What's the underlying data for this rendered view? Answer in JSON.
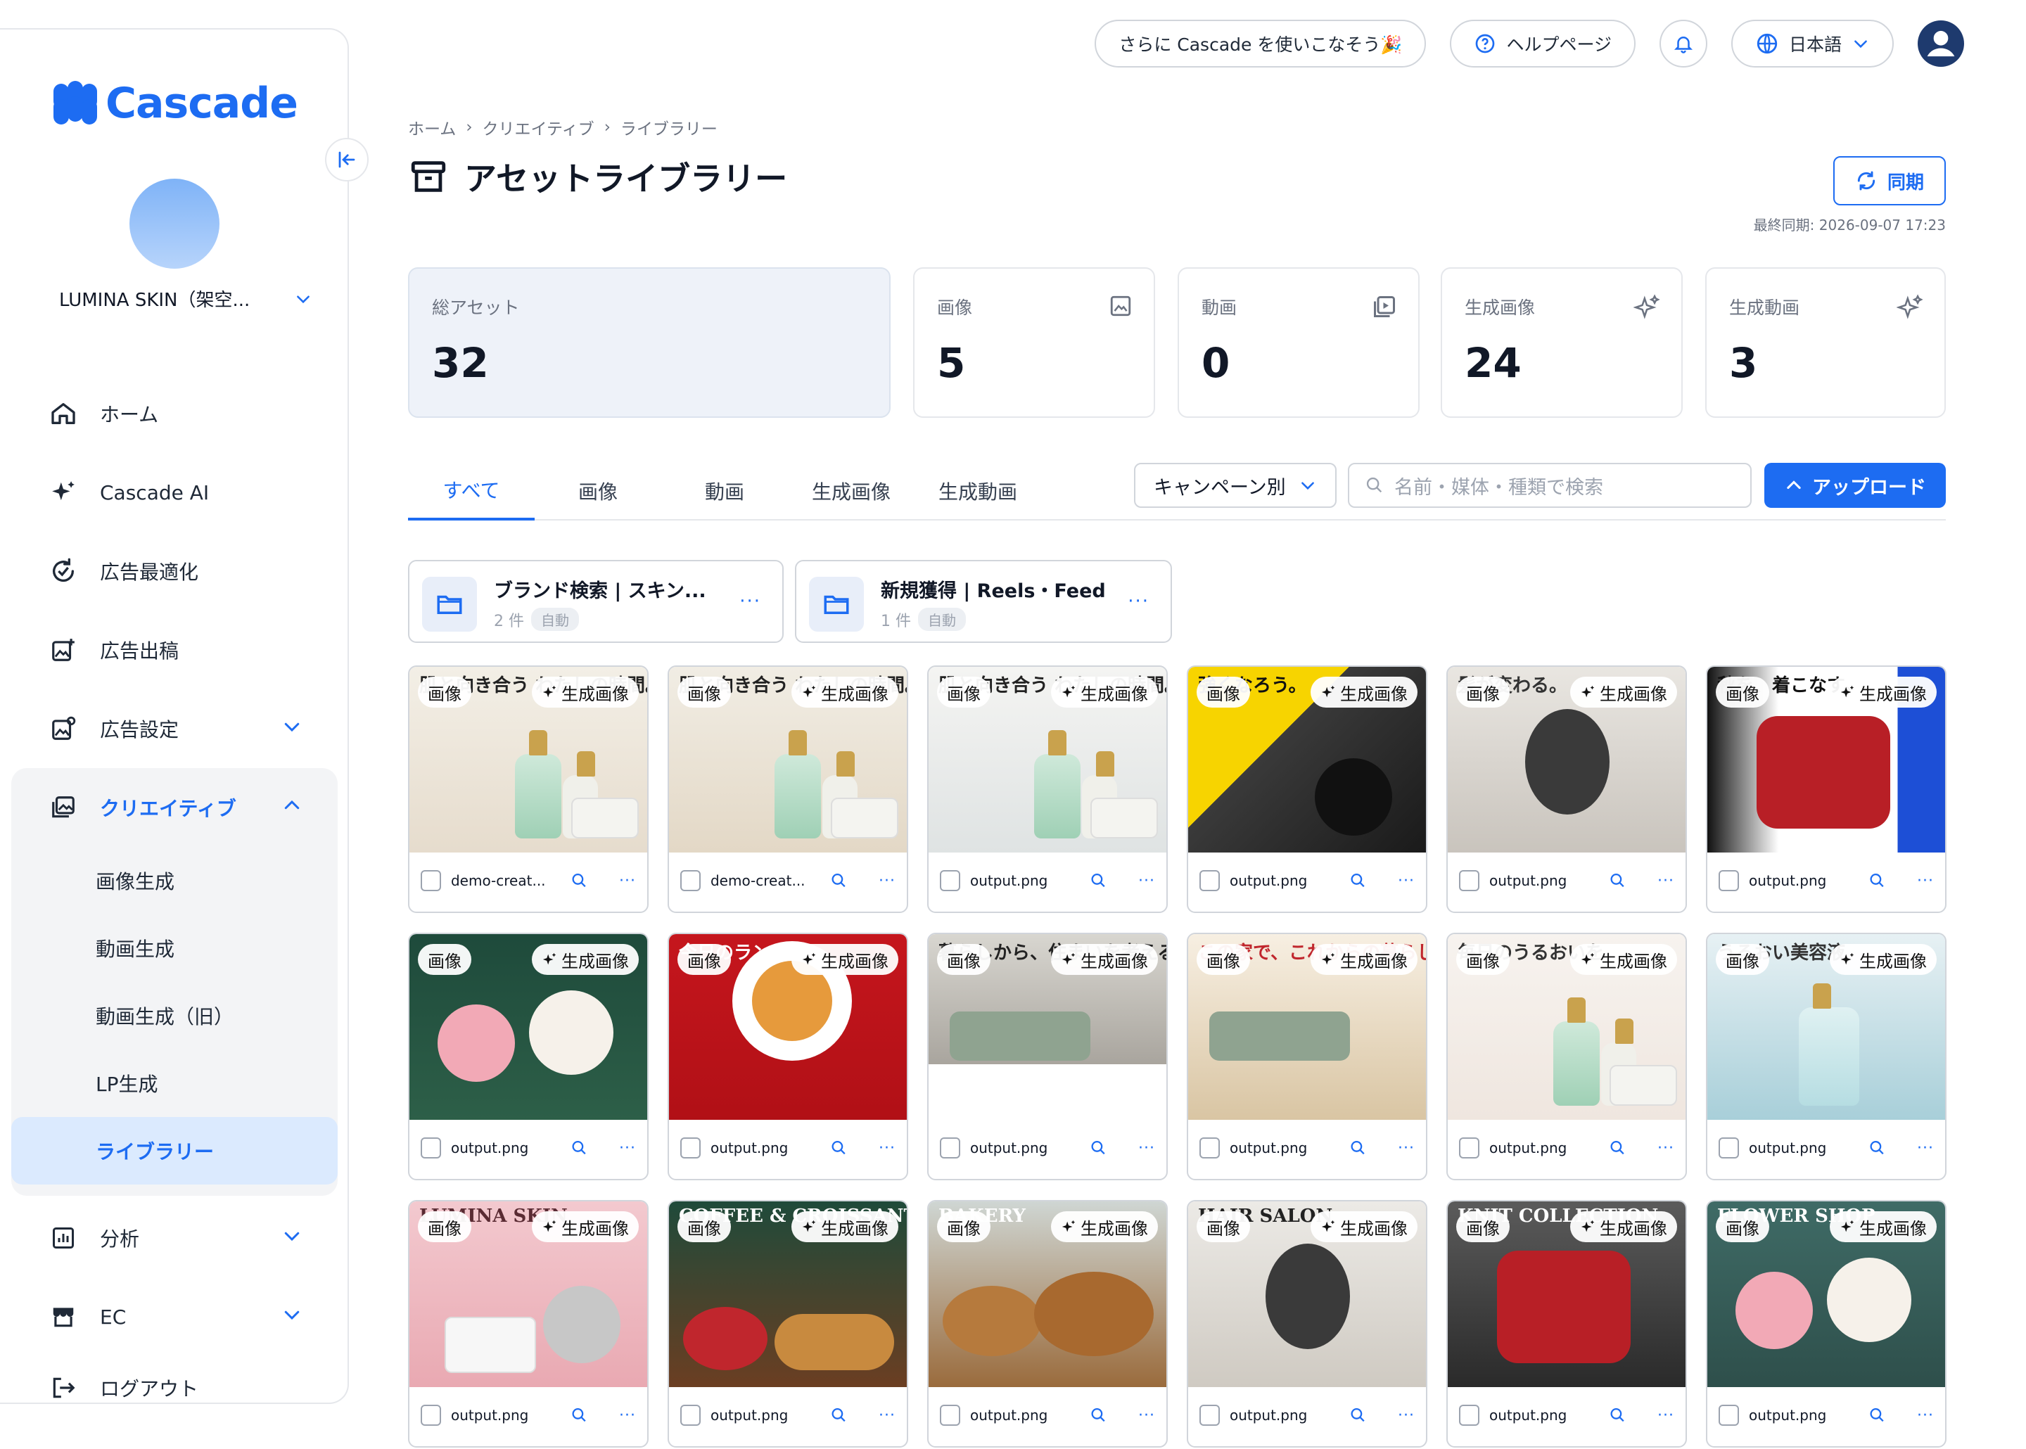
{
  "brand": {
    "name": "Cascade"
  },
  "account": {
    "name": "LUMINA SKIN（架空..."
  },
  "nav": [
    {
      "label": "ホーム",
      "icon": "home-icon"
    },
    {
      "label": "Cascade AI",
      "icon": "sparkle-icon"
    },
    {
      "label": "広告最適化",
      "icon": "refresh-check-icon"
    },
    {
      "label": "広告出稿",
      "icon": "image-plus-icon"
    },
    {
      "label": "広告設定",
      "icon": "image-settings-icon"
    }
  ],
  "creative": {
    "label": "クリエイティブ",
    "children": [
      "画像生成",
      "動画生成",
      "動画生成（旧）",
      "LP生成",
      "ライブラリー"
    ]
  },
  "nav_bottom": [
    {
      "label": "分析",
      "icon": "chart-icon"
    },
    {
      "label": "EC",
      "icon": "store-icon"
    },
    {
      "label": "ログアウト",
      "icon": "logout-icon"
    }
  ],
  "topbar": {
    "promo": "さらに Cascade を使いこなそう🎉",
    "help": "ヘルプページ",
    "language": "日本語"
  },
  "breadcrumb": [
    "ホーム",
    "クリエイティブ",
    "ライブラリー"
  ],
  "page_title": "アセットライブラリー",
  "sync": {
    "label": "同期",
    "last": "最終同期: 2026-09-07 17:23"
  },
  "stats": [
    {
      "label": "総アセット",
      "value": "32"
    },
    {
      "label": "画像",
      "value": "5"
    },
    {
      "label": "動画",
      "value": "0"
    },
    {
      "label": "生成画像",
      "value": "24"
    },
    {
      "label": "生成動画",
      "value": "3"
    }
  ],
  "tabs": [
    "すべて",
    "画像",
    "動画",
    "生成画像",
    "生成動画"
  ],
  "campaign_filter": "キャンペーン別",
  "search_placeholder": "名前・媒体・種類で検索",
  "upload_label": "アップロード",
  "folders": [
    {
      "name": "ブランド検索 | スキン...",
      "count": "2 件",
      "tag": "自動"
    },
    {
      "name": "新規獲得 | Reels・Feed",
      "count": "1 件",
      "tag": "自動"
    }
  ],
  "badge_type": "画像",
  "badge_gen": "生成画像",
  "assets": [
    {
      "file": "demo-creat...",
      "headline": "肌と向き合う わたしの時間。"
    },
    {
      "file": "demo-creat...",
      "headline": "肌と向き合う わたしの時間。"
    },
    {
      "file": "output.png",
      "headline": "肌と向き合う わたしの時間。"
    },
    {
      "file": "output.png",
      "headline": "強くなろう。"
    },
    {
      "file": "output.png",
      "headline": "髪が変わる。"
    },
    {
      "file": "output.png",
      "headline": "秋を、着こなす。"
    },
    {
      "file": "output.png",
      "headline": ""
    },
    {
      "file": "output.png",
      "headline": "今日のランチは、"
    },
    {
      "file": "output.png",
      "headline": "暮らしから、住まいを考える。"
    },
    {
      "file": "output.png",
      "headline": "この家で、これからの暮らしを。"
    },
    {
      "file": "output.png",
      "headline": "毎日のうるおいを"
    },
    {
      "file": "output.png",
      "headline": "うるおい美容液"
    },
    {
      "file": "output.png",
      "headline": "LUMINA SKIN"
    },
    {
      "file": "output.png",
      "headline": "COFFEE & CROISSANT"
    },
    {
      "file": "output.png",
      "headline": "BAKERY"
    },
    {
      "file": "output.png",
      "headline": "HAIR SALON"
    },
    {
      "file": "output.png",
      "headline": "KNIT COLLECTION"
    },
    {
      "file": "output.png",
      "headline": "FLOWER SHOP"
    }
  ],
  "colors": {
    "accent": "#1d6cf2",
    "active_bg": "#dbeafe"
  }
}
